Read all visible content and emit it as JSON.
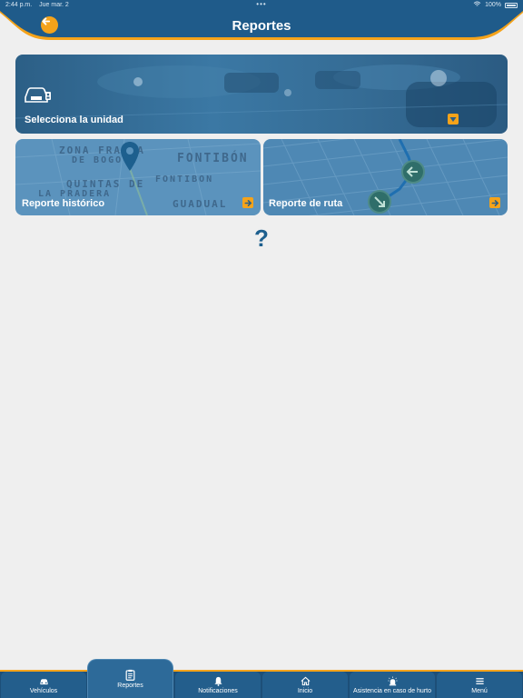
{
  "status": {
    "time": "2:44 p.m.",
    "date": "Jue mar. 2",
    "battery": "100%"
  },
  "header": {
    "title": "Reportes"
  },
  "cards": {
    "unit": {
      "label": "Selecciona la unidad",
      "icon": "car-id-icon"
    },
    "historic": {
      "label": "Reporte histórico",
      "map_labels": [
        "ZONA FRANCA",
        "DE BOGOTÁ",
        "FONTIBÓN",
        "FONTIBON",
        "QUINTAS DE",
        "LA PRADERA",
        "GUADUAL"
      ]
    },
    "route": {
      "label": "Reporte de ruta"
    }
  },
  "help": {
    "symbol": "?"
  },
  "nav": {
    "items": [
      {
        "label": "Vehículos",
        "icon": "car-icon"
      },
      {
        "label": "Reportes",
        "icon": "clipboard-icon"
      },
      {
        "label": "Notificaciones",
        "icon": "bell-icon"
      },
      {
        "label": "Inicio",
        "icon": "home-icon"
      },
      {
        "label": "Asistencia en caso de hurto",
        "icon": "siren-icon"
      },
      {
        "label": "Menú",
        "icon": "menu-icon"
      }
    ]
  },
  "colors": {
    "primary": "#1d5f8e",
    "accent": "#f5a31a",
    "background": "#efefef"
  }
}
